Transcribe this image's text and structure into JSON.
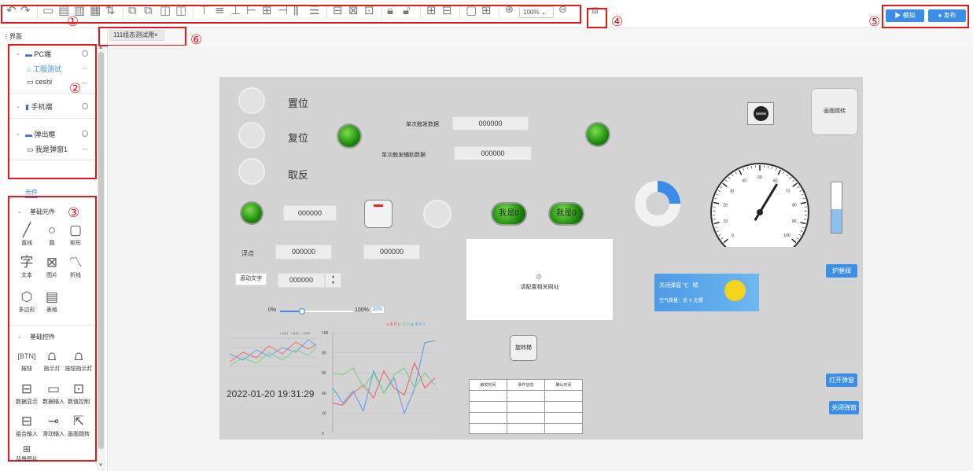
{
  "markers": {
    "m1": "①",
    "m2": "②",
    "m3": "③",
    "m4": "④",
    "m5": "⑤",
    "m6": "⑥"
  },
  "toolbar": {
    "zoom": "100%",
    "simulate": "▶ 模拟",
    "publish": "● 发布"
  },
  "panel_title": "界面",
  "tab": {
    "label": "111组态测试用",
    "close": "×"
  },
  "tree": {
    "groups": [
      {
        "label": "PC端",
        "items": [
          {
            "label": "工程测试"
          },
          {
            "label": "ceshi"
          }
        ]
      },
      {
        "label": "手机端",
        "items": []
      },
      {
        "label": "弹出框",
        "items": [
          {
            "label": "我是弹窗1"
          }
        ]
      }
    ],
    "more": "···"
  },
  "components_tab": "元件",
  "basic_elements": {
    "title": "基础元件",
    "items": [
      "直线",
      "圆",
      "矩形",
      "文本",
      "图片",
      "折线",
      "多边形",
      "表格"
    ]
  },
  "basic_controls": {
    "title": "基础控件",
    "items": [
      "按钮",
      "指示灯",
      "按钮指示灯",
      "数据显示",
      "数据输入",
      "数值控制",
      "组合输入",
      "滑动输入",
      "画面跳转",
      "背景图片"
    ]
  },
  "canvas": {
    "zhiwei": "置位",
    "fuwei": "复位",
    "qufan": "取反",
    "single_trigger": "单次触发数据",
    "single_trigger_value": "000000",
    "single_trigger_aux": "单次触发辅助数据",
    "single_trigger_aux_value": "000000",
    "value_row": "000000",
    "float_label": "浮点",
    "float_value": "000000",
    "float_value2": "000000",
    "scroll_text": "滚动文字",
    "stepper_value": "000000",
    "slider_min": "0%",
    "slider_max": "100%",
    "slider_badge": "30%",
    "led_text1": "我是0",
    "led_text2": "我是0",
    "jump_label": "画面跳转",
    "iframe_text": "请配置相关网址",
    "rotate_btn": "旋转梯",
    "datetime": "2022-01-20 19:31:29",
    "weather_title": "关闭弹窗",
    "weather_unit": "℃",
    "weather_sub": "空气质量：优",
    "weather_city": "无锡",
    "weather_extra": "晴",
    "btn_fan": "炉膛阀",
    "btn_open": "打开弹窗",
    "btn_close": "关闭弹窗",
    "table_headers": [
      "触发时间",
      "事件信息",
      "确认时间"
    ],
    "legend": [
      "● 系列1",
      "● 系列2",
      "● 系列3"
    ],
    "gauge_ticks": [
      "0",
      "10",
      "20",
      "30",
      "40",
      "50",
      "60",
      "70",
      "80",
      "90",
      "100"
    ]
  },
  "colors": {
    "accent": "#1890ff",
    "red": "#e4181b",
    "canvas": "#d3d3d3"
  }
}
